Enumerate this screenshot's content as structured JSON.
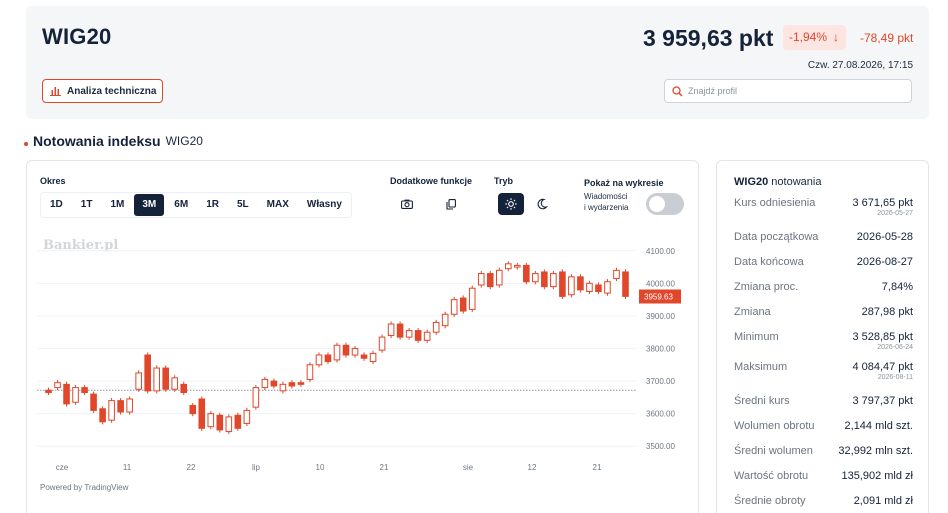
{
  "header": {
    "ticker": "WIG20",
    "price": "3 959,63 pkt",
    "change_pct": "-1,94%",
    "change_abs": "-78,49 pkt",
    "datetime": "Czw. 27.08.2026, 17:15",
    "ta_button": "Analiza techniczna",
    "search_placeholder": "Znajdź profil",
    "colors": {
      "accent": "#e0472b",
      "dark": "#14223a"
    }
  },
  "section": {
    "title": "Notowania indeksu",
    "subtitle": "WIG20"
  },
  "chart_panel": {
    "period_label": "Okres",
    "periods": [
      "1D",
      "1T",
      "1M",
      "3M",
      "6M",
      "1R",
      "5L",
      "MAX",
      "Własny"
    ],
    "active_period": "3M",
    "extra_label": "Dodatkowe funkcje",
    "extra_icons": [
      "camera-icon",
      "copy-icon"
    ],
    "mode_label": "Tryb",
    "mode_icons": [
      "sun-icon",
      "moon-icon"
    ],
    "show_label": "Pokaż na wykresie",
    "events_label_1": "Wiadomości",
    "events_label_2": "i wydarzenia",
    "events_on": false,
    "watermark": "Bankier.pl",
    "powered": "Powered by TradingView"
  },
  "chart_data": {
    "type": "candlestick",
    "y_ticks": [
      "4100.00",
      "4000.00",
      "3900.00",
      "3800.00",
      "3700.00",
      "3600.00",
      "3500.00"
    ],
    "x_ticks": [
      "cze",
      "11",
      "22",
      "lip",
      "10",
      "21",
      "sie",
      "12",
      "21"
    ],
    "ylim": [
      3470,
      4130
    ],
    "last_price_label": "3959.63",
    "reference_level": 3671.65,
    "colors": {
      "up": "#e0472b",
      "down": "#e0472b"
    },
    "candles": [
      {
        "o": 3672,
        "c": 3665
      },
      {
        "o": 3680,
        "c": 3695
      },
      {
        "o": 3690,
        "c": 3630
      },
      {
        "o": 3635,
        "c": 3680
      },
      {
        "o": 3680,
        "c": 3665
      },
      {
        "o": 3660,
        "c": 3610
      },
      {
        "o": 3615,
        "c": 3575
      },
      {
        "o": 3580,
        "c": 3640
      },
      {
        "o": 3640,
        "c": 3605
      },
      {
        "o": 3605,
        "c": 3645
      },
      {
        "o": 3675,
        "c": 3725
      },
      {
        "o": 3780,
        "c": 3670
      },
      {
        "o": 3670,
        "c": 3740
      },
      {
        "o": 3740,
        "c": 3675
      },
      {
        "o": 3675,
        "c": 3710
      },
      {
        "o": 3690,
        "c": 3665
      },
      {
        "o": 3625,
        "c": 3600
      },
      {
        "o": 3645,
        "c": 3555
      },
      {
        "o": 3560,
        "c": 3600
      },
      {
        "o": 3595,
        "c": 3550
      },
      {
        "o": 3545,
        "c": 3590
      },
      {
        "o": 3595,
        "c": 3555
      },
      {
        "o": 3570,
        "c": 3610
      },
      {
        "o": 3620,
        "c": 3680
      },
      {
        "o": 3680,
        "c": 3705
      },
      {
        "o": 3700,
        "c": 3685
      },
      {
        "o": 3670,
        "c": 3690
      },
      {
        "o": 3695,
        "c": 3685
      },
      {
        "o": 3695,
        "c": 3690
      },
      {
        "o": 3705,
        "c": 3750
      },
      {
        "o": 3750,
        "c": 3780
      },
      {
        "o": 3780,
        "c": 3760
      },
      {
        "o": 3765,
        "c": 3810
      },
      {
        "o": 3810,
        "c": 3780
      },
      {
        "o": 3780,
        "c": 3800
      },
      {
        "o": 3780,
        "c": 3770
      },
      {
        "o": 3760,
        "c": 3785
      },
      {
        "o": 3795,
        "c": 3835
      },
      {
        "o": 3840,
        "c": 3875
      },
      {
        "o": 3875,
        "c": 3835
      },
      {
        "o": 3835,
        "c": 3855
      },
      {
        "o": 3855,
        "c": 3825
      },
      {
        "o": 3825,
        "c": 3850
      },
      {
        "o": 3850,
        "c": 3880
      },
      {
        "o": 3870,
        "c": 3905
      },
      {
        "o": 3905,
        "c": 3950
      },
      {
        "o": 3955,
        "c": 3915
      },
      {
        "o": 3920,
        "c": 3985
      },
      {
        "o": 3995,
        "c": 4030
      },
      {
        "o": 4030,
        "c": 3990
      },
      {
        "o": 3995,
        "c": 4040
      },
      {
        "o": 4045,
        "c": 4060
      },
      {
        "o": 4050,
        "c": 4055
      },
      {
        "o": 4055,
        "c": 4005
      },
      {
        "o": 4005,
        "c": 4030
      },
      {
        "o": 4035,
        "c": 3990
      },
      {
        "o": 3990,
        "c": 4030
      },
      {
        "o": 4035,
        "c": 3960
      },
      {
        "o": 3965,
        "c": 4020
      },
      {
        "o": 4020,
        "c": 3980
      },
      {
        "o": 3975,
        "c": 4000
      },
      {
        "o": 3995,
        "c": 3975
      },
      {
        "o": 3970,
        "c": 4005
      },
      {
        "o": 4015,
        "c": 4040
      },
      {
        "o": 4035,
        "c": 3960
      }
    ]
  },
  "sidebar": {
    "title": "WIG20",
    "title_suffix": "notowania",
    "rows": [
      {
        "label": "Kurs odniesienia",
        "value": "3 671,65 pkt",
        "date": "2026-05-27"
      },
      {
        "label": "Data początkowa",
        "value": "2026-05-28",
        "date": ""
      },
      {
        "label": "Data końcowa",
        "value": "2026-08-27",
        "date": ""
      },
      {
        "label": "Zmiana proc.",
        "value": "7,84%",
        "date": ""
      },
      {
        "label": "Zmiana",
        "value": "287,98 pkt",
        "date": ""
      },
      {
        "label": "Minimum",
        "value": "3 528,85 pkt",
        "date": "2026-06-24"
      },
      {
        "label": "Maksimum",
        "value": "4 084,47 pkt",
        "date": "2026-08-11"
      },
      {
        "label": "Średni kurs",
        "value": "3 797,37 pkt",
        "date": ""
      },
      {
        "label": "Wolumen obrotu",
        "value": "2,144 mld szt.",
        "date": ""
      },
      {
        "label": "Średni wolumen",
        "value": "32,992 mln szt.",
        "date": ""
      },
      {
        "label": "Wartość obrotu",
        "value": "135,902 mld zł",
        "date": ""
      },
      {
        "label": "Średnie obroty",
        "value": "2,091 mld zł",
        "date": ""
      }
    ]
  }
}
